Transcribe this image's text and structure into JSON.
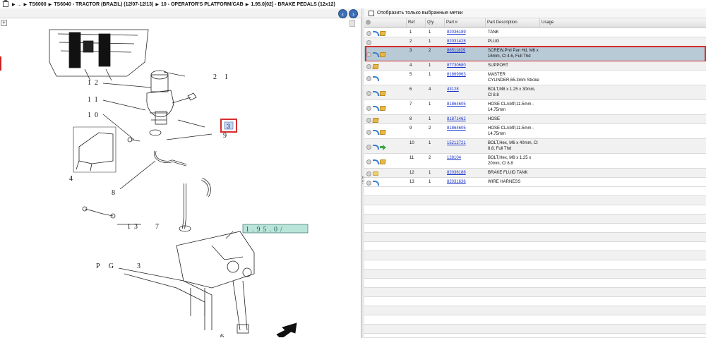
{
  "breadcrumb": {
    "items": [
      "...",
      "TS6000",
      "TS6040 - TRACTOR (BRAZIL) (12/07-12/13)",
      "10 - OPERATOR'S PLATFORM/CAB",
      "1.95.0[02] - BRAKE PEDALS (12x12)"
    ]
  },
  "drawing": {
    "zoom_symbol": "+",
    "callouts": [
      "12",
      "11",
      "10",
      "4",
      "8",
      "13",
      "7",
      "2",
      "1",
      "9",
      "6",
      "3"
    ],
    "pg_label": "P G",
    "ref_box_text": "1.95.0/",
    "selected_callout": "3"
  },
  "filter": {
    "label": "Отобразить только выбранные метки",
    "checked": false
  },
  "grid": {
    "columns": [
      "",
      "Ref",
      "Qty",
      "Part #",
      "Part Description",
      "Usage"
    ],
    "rows": [
      {
        "ref": "1",
        "qty": "1",
        "part": "82036189",
        "desc": "TANK",
        "icons": [
          "add",
          "back",
          "box"
        ],
        "selected": false
      },
      {
        "ref": "2",
        "qty": "1",
        "part": "82031428",
        "desc": "PLUG",
        "icons": [
          "add",
          "spacer",
          "spacer"
        ],
        "selected": false
      },
      {
        "ref": "3",
        "qty": "2",
        "part": "86511829",
        "desc": "SCREW,Phil Pan Hd, M6 x 16mm, Cl 4.6, Full Thd",
        "icons": [
          "add",
          "back",
          "box"
        ],
        "selected": true
      },
      {
        "ref": "4",
        "qty": "1",
        "part": "87730680",
        "desc": "SUPPORT",
        "icons": [
          "add",
          "box",
          "spacer"
        ],
        "selected": false
      },
      {
        "ref": "5",
        "qty": "1",
        "part": "81869963",
        "desc": "MASTER CYLINDER,65.3mm Stroke",
        "icons": [
          "add",
          "back",
          "spacer"
        ],
        "selected": false
      },
      {
        "ref": "6",
        "qty": "4",
        "part": "43128",
        "desc": "BOLT,M8 x 1.25 x 30mm, Cl 8.8",
        "icons": [
          "add",
          "back",
          "box"
        ],
        "selected": false
      },
      {
        "ref": "7",
        "qty": "1",
        "part": "81864605",
        "desc": "HOSE CLAMP,11.5mm - 14.75mm",
        "icons": [
          "add",
          "back",
          "box"
        ],
        "selected": false
      },
      {
        "ref": "8",
        "qty": "1",
        "part": "81871462",
        "desc": "HOSE",
        "icons": [
          "add",
          "box",
          "spacer"
        ],
        "selected": false
      },
      {
        "ref": "9",
        "qty": "2",
        "part": "81864605",
        "desc": "HOSE CLAMP,11.5mm - 14.75mm",
        "icons": [
          "add",
          "back",
          "box"
        ],
        "selected": false
      },
      {
        "ref": "10",
        "qty": "1",
        "part": "15212721",
        "desc": "BOLT,Hex, M6 x 40mm, Cl 8.8, Full Thd",
        "icons": [
          "add",
          "back",
          "arrow"
        ],
        "selected": false
      },
      {
        "ref": "11",
        "qty": "2",
        "part": "128104",
        "desc": "BOLT,Hex, M8 x 1.25 x 20mm, Cl 8.8",
        "icons": [
          "add",
          "back",
          "box"
        ],
        "selected": false
      },
      {
        "ref": "12",
        "qty": "1",
        "part": "82036188",
        "desc": "BRAKE FLUID TANK",
        "icons": [
          "add",
          "folder",
          "spacer"
        ],
        "selected": false
      },
      {
        "ref": "13",
        "qty": "1",
        "part": "82031636",
        "desc": "WIRE HARNESS",
        "icons": [
          "add",
          "back",
          "spacer"
        ],
        "selected": false
      }
    ]
  },
  "colors": {
    "link": "#1a33cc",
    "selected_row": "#b9cad7",
    "highlight_outline": "#d62d2d",
    "nav_button": "#3d6fb4"
  }
}
